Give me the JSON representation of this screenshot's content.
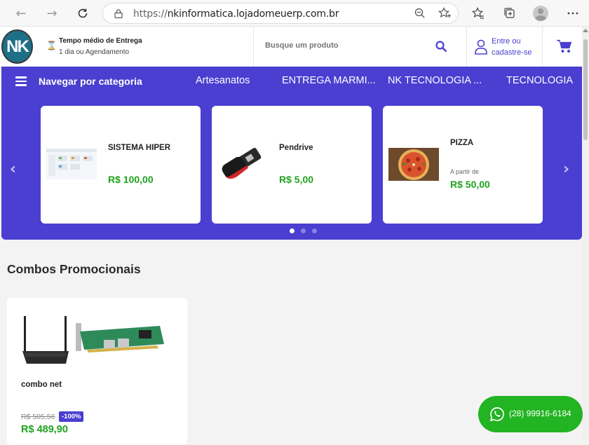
{
  "browser": {
    "url_scheme": "https://",
    "url_host": "nkinformatica.lojadomeuerp.com.br",
    "nav_icons": [
      "back-icon",
      "forward-icon",
      "refresh-icon"
    ],
    "toolbar_icons": [
      "zoom-out-icon",
      "add-favorite-icon",
      "favorites-icon",
      "collections-icon",
      "profile-icon",
      "more-icon"
    ]
  },
  "header": {
    "logo_text": "NK",
    "delivery_title": "Tempo médio de Entrega",
    "delivery_subtitle": "1 dia ou Agendamento",
    "search_placeholder": "Busque um produto",
    "login_line1": "Entre ou",
    "login_line2": "cadastre-se"
  },
  "category_bar": {
    "menu_label": "Navegar por categoria",
    "links": [
      "Artesanatos",
      "ENTREGA MARMI...",
      "NK TECNOLOGIA ...",
      "TECNOLOGIA"
    ]
  },
  "carousel": {
    "items": [
      {
        "name": "SISTEMA HIPER",
        "from": "",
        "price": "R$ 100,00"
      },
      {
        "name": "Pendrive",
        "from": "",
        "price": "R$ 5,00"
      },
      {
        "name": "PIZZA",
        "from": "A partir de",
        "price": "R$ 50,00"
      }
    ],
    "page_count": 3,
    "active_page": 1
  },
  "combos": {
    "title": "Combos Promocionais",
    "items": [
      {
        "name": "combo net",
        "old_price": "R$ 505,56",
        "discount": "-100%",
        "price": "R$ 489,90"
      }
    ]
  },
  "whatsapp": {
    "phone": "(28) 99916-6184"
  },
  "colors": {
    "brand_purple": "#4a3fd0",
    "price_green": "#1fa31f",
    "whatsapp_green": "#22b422",
    "logo_teal": "#1e6f88"
  }
}
